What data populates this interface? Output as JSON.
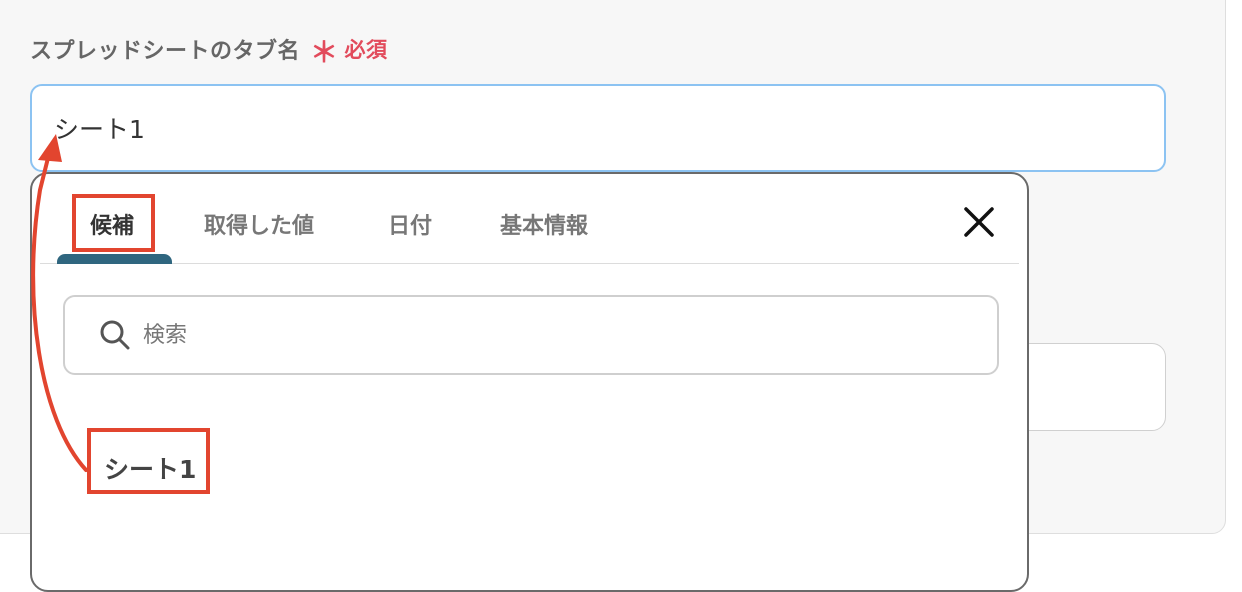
{
  "field": {
    "label": "スプレッドシートのタブ名",
    "required_mark": "＊",
    "required_text": "必須",
    "value": "シート1"
  },
  "dropdown": {
    "tabs": [
      {
        "label": "候補",
        "active": true
      },
      {
        "label": "取得した値",
        "active": false
      },
      {
        "label": "日付",
        "active": false
      },
      {
        "label": "基本情報",
        "active": false
      }
    ],
    "search_placeholder": "検索",
    "candidates": [
      "シート1"
    ]
  },
  "colors": {
    "accent_tab": "#2f667f",
    "highlight": "#e2452f",
    "required": "#e24b5c",
    "input_focus_border": "#8cc3f2"
  },
  "icons": [
    "search-icon",
    "close-icon",
    "arrow-annotation"
  ]
}
